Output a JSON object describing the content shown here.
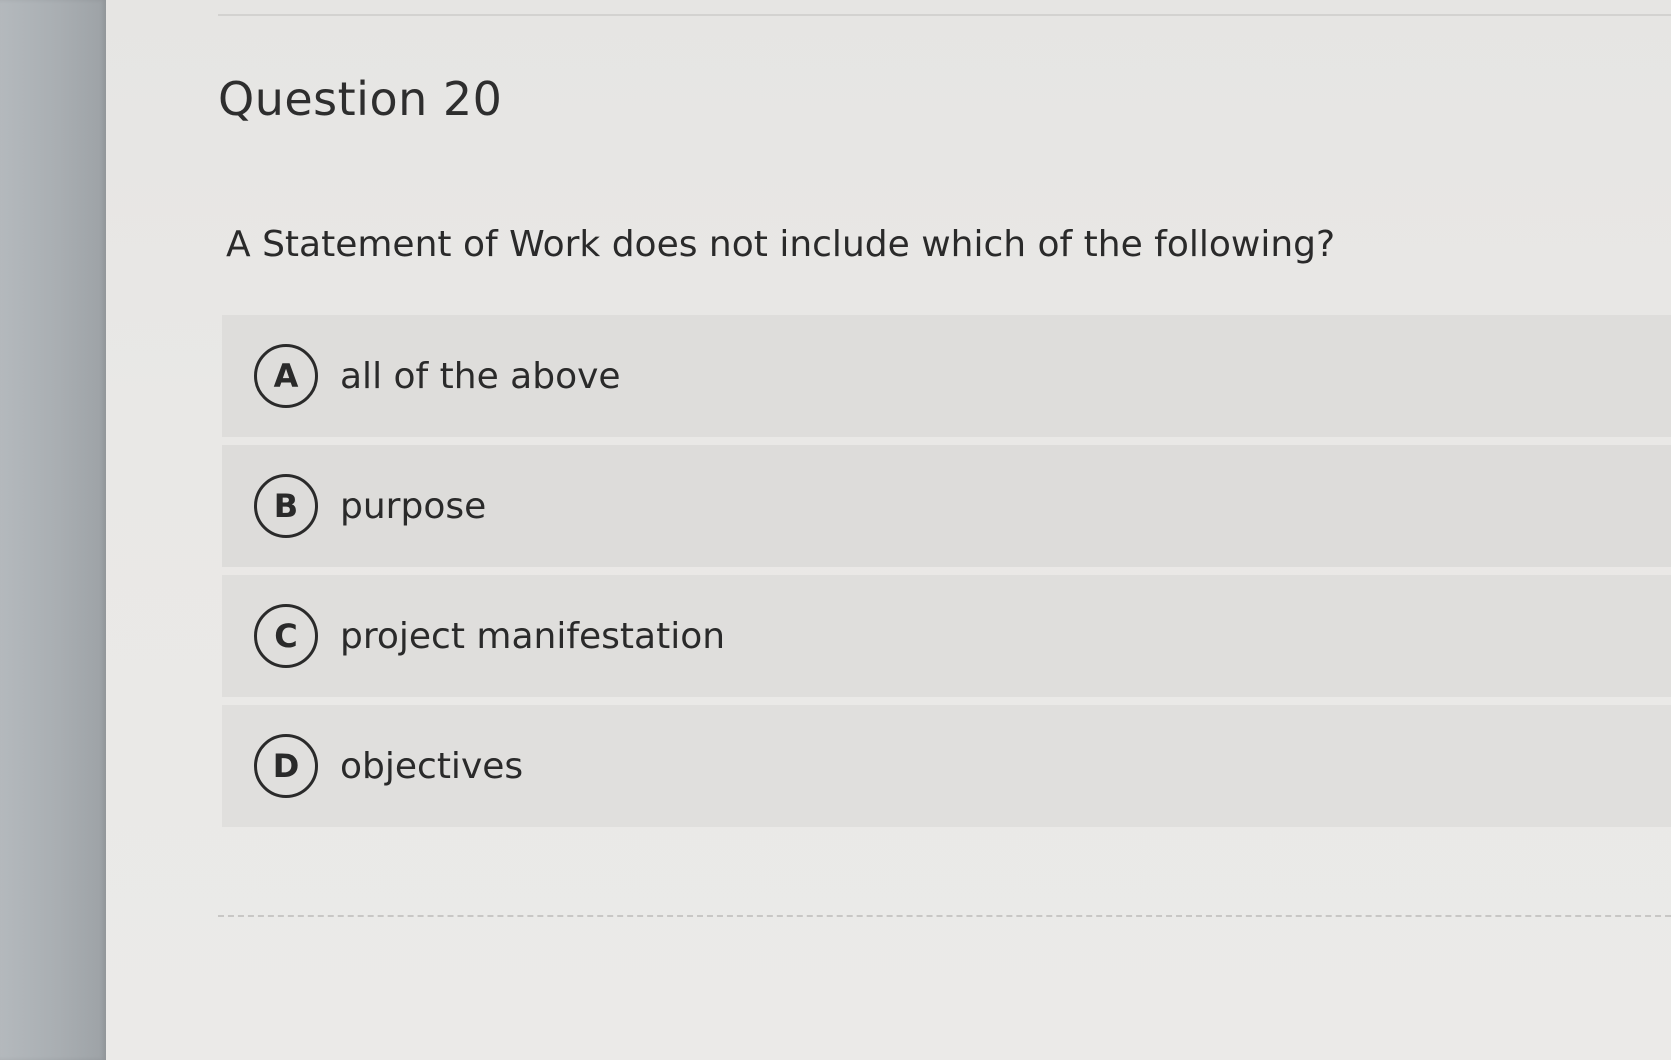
{
  "question": {
    "title": "Question 20",
    "text": "A Statement of Work does not include which of the following?"
  },
  "options": [
    {
      "letter": "A",
      "label": "all of the above"
    },
    {
      "letter": "B",
      "label": "purpose"
    },
    {
      "letter": "C",
      "label": "project manifestation"
    },
    {
      "letter": "D",
      "label": "objectives"
    }
  ],
  "colors": {
    "background": "#e3e2e0",
    "option_row": "#dedddb",
    "text": "#2a2a2a",
    "left_bar": "#a9aeb2"
  }
}
